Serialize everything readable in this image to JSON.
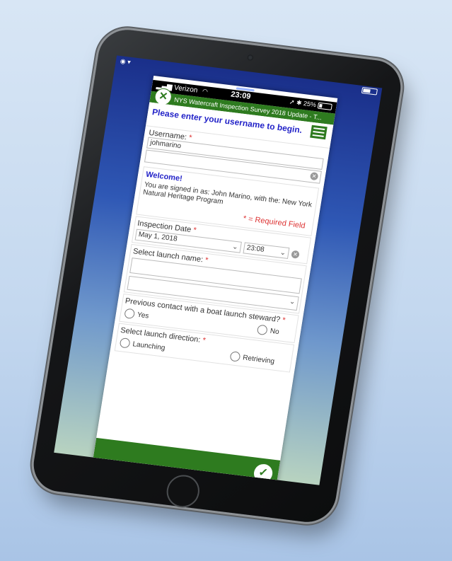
{
  "status": {
    "carrier": "Verizon",
    "time": "23:09",
    "battery": "25%"
  },
  "app": {
    "title": "NYS Watercraft Inspection Survey 2018 Update - T..."
  },
  "banner": {
    "text": "Please enter your username to begin."
  },
  "form": {
    "username_label": "Username:",
    "username_value": "johmarino",
    "welcome_title": "Welcome!",
    "welcome_text": "You are signed in as: John Marino, with the: New York Natural Heritage Program",
    "required_note": "* = Required Field",
    "date_label": "Inspection Date",
    "date_value": "May 1, 2018",
    "time_value": "23:08",
    "launch_label": "Select launch name:",
    "contact_label": "Previous contact with a boat launch steward?",
    "yes_label": "Yes",
    "no_label": "No",
    "direction_label": "Select launch direction:",
    "launching_label": "Launching",
    "retrieving_label": "Retrieving",
    "required_mark": "*"
  },
  "icons": {
    "close": "close-icon",
    "menu": "menu-icon",
    "submit": "check-icon"
  },
  "colors": {
    "brand_green": "#2e7b1f",
    "banner_blue": "#2323c8",
    "required_red": "#dd3333"
  }
}
